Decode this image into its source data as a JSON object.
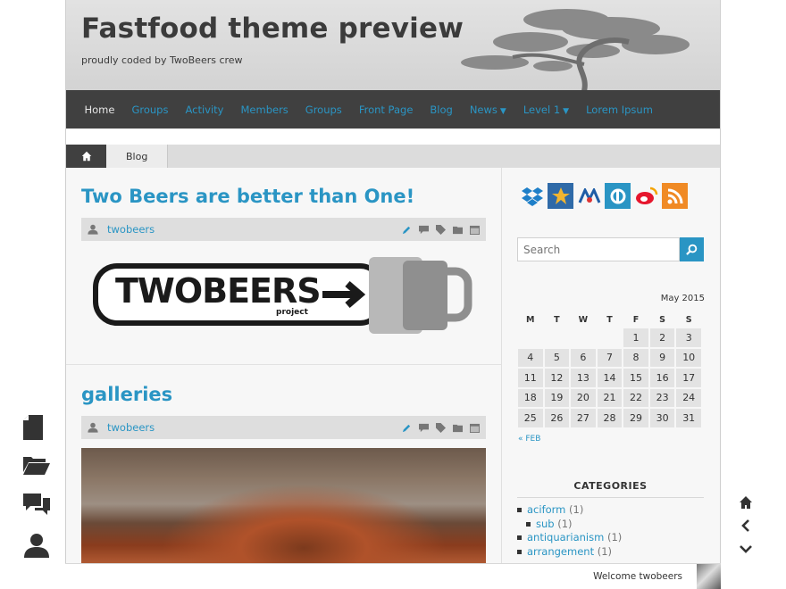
{
  "site": {
    "title": "Fastfood theme preview",
    "description": "proudly coded by TwoBeers crew"
  },
  "nav": {
    "items": [
      {
        "label": "Home",
        "current": true
      },
      {
        "label": "Groups"
      },
      {
        "label": "Activity"
      },
      {
        "label": "Members"
      },
      {
        "label": "Groups"
      },
      {
        "label": "Front Page"
      },
      {
        "label": "Blog"
      },
      {
        "label": "News",
        "caret": "chevron-down-icon"
      },
      {
        "label": "Level 1",
        "caret": "chevron-down-icon"
      },
      {
        "label": "Lorem Ipsum"
      }
    ]
  },
  "breadcrumb": {
    "home_icon": "home-icon",
    "current": "Blog"
  },
  "posts": [
    {
      "title": "Two Beers are better than One!",
      "author": "twobeers",
      "image_text": "TWOBEERS",
      "image_subtext": "project"
    },
    {
      "title": "galleries",
      "author": "twobeers"
    }
  ],
  "sidebar": {
    "social_icons": [
      "dropbox-icon",
      "favourites-icon",
      "delicious-icon",
      "picasa-icon",
      "weibo-icon",
      "rss-icon"
    ],
    "search": {
      "placeholder": "Search"
    },
    "calendar": {
      "caption": "May 2015",
      "weekdays": [
        "M",
        "T",
        "W",
        "T",
        "F",
        "S",
        "S"
      ],
      "weeks": [
        [
          "",
          "",
          "",
          "",
          "1",
          "2",
          "3"
        ],
        [
          "4",
          "5",
          "6",
          "7",
          "8",
          "9",
          "10"
        ],
        [
          "11",
          "12",
          "13",
          "14",
          "15",
          "16",
          "17"
        ],
        [
          "18",
          "19",
          "20",
          "21",
          "22",
          "23",
          "24"
        ],
        [
          "25",
          "26",
          "27",
          "28",
          "29",
          "30",
          "31"
        ]
      ],
      "prev_link": "« FEB"
    },
    "categories": {
      "title": "CATEGORIES",
      "items": [
        {
          "name": "aciform",
          "count": "(1)"
        },
        {
          "name": "sub",
          "count": "(1)",
          "sub": true
        },
        {
          "name": "antiquarianism",
          "count": "(1)"
        },
        {
          "name": "arrangement",
          "count": "(1)"
        }
      ]
    }
  },
  "footer": {
    "welcome": "Welcome twobeers"
  },
  "left_toolbar": [
    "page-icon",
    "folder-icon",
    "comments-icon",
    "user-icon"
  ],
  "right_toolbar": [
    "home-icon",
    "chevron-left-icon",
    "chevron-down-icon"
  ],
  "colors": {
    "accent": "#2a95c4",
    "nav_bg": "#404040",
    "header_bg": "#d8d8d8"
  }
}
